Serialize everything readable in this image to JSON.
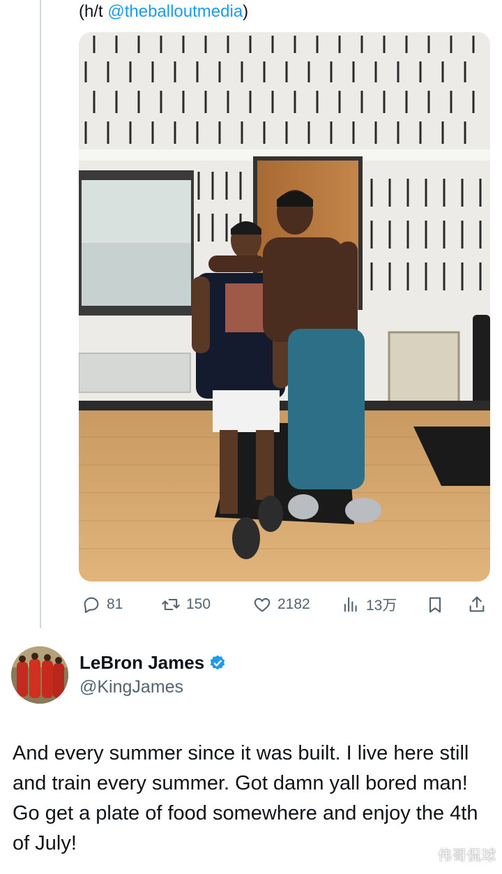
{
  "post": {
    "hat_tip_prefix": "(h/t ",
    "hat_tip_mention": "@theballoutmedia",
    "hat_tip_suffix": ")"
  },
  "actions": {
    "reply_count": "81",
    "retweet_count": "150",
    "like_count": "2182",
    "view_count": "13万"
  },
  "reply": {
    "author_name": "LeBron James",
    "author_handle": "@KingJames",
    "text": "And every summer since it was built. I live here still and train every summer. Got damn yall bored man! Go get a plate of food somewhere and enjoy the 4th of July!"
  },
  "watermark": "伟哥侃球",
  "icons": {
    "reply": "reply-icon",
    "retweet": "retweet-icon",
    "like": "heart-icon",
    "views": "views-icon",
    "bookmark": "bookmark-icon",
    "share": "share-icon",
    "verified": "verified-badge-icon"
  },
  "colors": {
    "accent": "#1d9bf0",
    "text": "#0f1419",
    "muted": "#536471"
  }
}
